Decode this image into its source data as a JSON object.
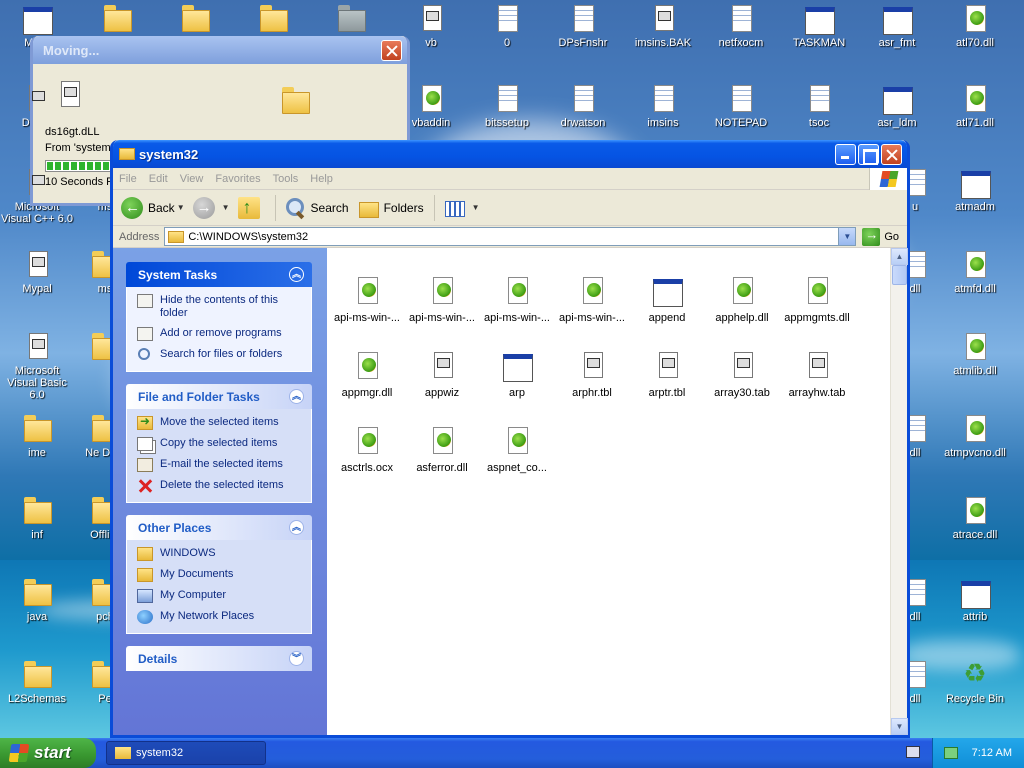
{
  "desktop": {
    "icons": [
      {
        "label": "My C",
        "kind": "win"
      },
      {
        "label": "",
        "kind": "folder"
      },
      {
        "label": "",
        "kind": "folder"
      },
      {
        "label": "",
        "kind": "folder"
      },
      {
        "label": "",
        "kind": "folder-gray"
      },
      {
        "label": "vb",
        "kind": "exe"
      },
      {
        "label": "0",
        "kind": "doc"
      },
      {
        "label": "DPsFnshr",
        "kind": "doc"
      },
      {
        "label": "imsins.BAK",
        "kind": "exe"
      },
      {
        "label": "netfxocm",
        "kind": "doc"
      },
      {
        "label": "TASKMAN",
        "kind": "win"
      },
      {
        "label": "asr_fmt",
        "kind": "win"
      },
      {
        "label": "atl70.dll",
        "kind": "dll"
      },
      {
        "label": "DataV",
        "kind": "exe"
      },
      {
        "label": "vbaddin",
        "kind": "dll"
      },
      {
        "label": "bitssetup",
        "kind": "doc"
      },
      {
        "label": "drwatson",
        "kind": "doc"
      },
      {
        "label": "imsins",
        "kind": "doc"
      },
      {
        "label": "NOTEPAD",
        "kind": "doc"
      },
      {
        "label": "tsoc",
        "kind": "doc"
      },
      {
        "label": "asr_ldm",
        "kind": "win"
      },
      {
        "label": "atl71.dll",
        "kind": "dll"
      },
      {
        "label": "Microsoft Visual C++ 6.0",
        "kind": "exe"
      },
      {
        "label": "ms",
        "kind": "folder"
      },
      {
        "label": "u",
        "kind": "doc"
      },
      {
        "label": "atmadm",
        "kind": "win"
      },
      {
        "label": "Mypal",
        "kind": "exe"
      },
      {
        "label": "ms",
        "kind": "folder"
      },
      {
        "label": "dll",
        "kind": "doc"
      },
      {
        "label": "atmfd.dll",
        "kind": "dll"
      },
      {
        "label": "Microsoft Visual Basic 6.0",
        "kind": "exe"
      },
      {
        "label": "",
        "kind": "folder"
      },
      {
        "label": "atmlib.dll",
        "kind": "dll"
      },
      {
        "label": "ime",
        "kind": "folder"
      },
      {
        "label": "Ne Diag",
        "kind": "folder"
      },
      {
        "label": "dll",
        "kind": "doc"
      },
      {
        "label": "atmpvcno.dll",
        "kind": "dll"
      },
      {
        "label": "inf",
        "kind": "folder"
      },
      {
        "label": "Offli P",
        "kind": "folder"
      },
      {
        "label": "atrace.dll",
        "kind": "dll"
      },
      {
        "label": "java",
        "kind": "folder"
      },
      {
        "label": "pch",
        "kind": "folder"
      },
      {
        "label": "dll",
        "kind": "doc"
      },
      {
        "label": "attrib",
        "kind": "win"
      },
      {
        "label": "L2Schemas",
        "kind": "folder"
      },
      {
        "label": "Pe",
        "kind": "folder"
      },
      {
        "label": "dll",
        "kind": "doc"
      },
      {
        "label": "Recycle Bin",
        "kind": "recycle"
      },
      {
        "label": "A",
        "kind": "doc"
      }
    ]
  },
  "moving_dialog": {
    "title": "Moving...",
    "file_name": "ds16gt.dLL",
    "from_text": "From 'system3",
    "time_text": "10 Seconds Re",
    "progress_blocks": 8
  },
  "explorer": {
    "title": "system32",
    "menu": [
      "File",
      "Edit",
      "View",
      "Favorites",
      "Tools",
      "Help"
    ],
    "toolbar": {
      "back": "Back",
      "search": "Search",
      "folders": "Folders"
    },
    "address": {
      "label": "Address",
      "value": "C:\\WINDOWS\\system32",
      "go": "Go"
    },
    "system_tasks": {
      "title": "System Tasks",
      "items": [
        {
          "label": "Hide the contents of this folder",
          "icon": "box"
        },
        {
          "label": "Add or remove programs",
          "icon": "box"
        },
        {
          "label": "Search for files or folders",
          "icon": "search"
        }
      ]
    },
    "file_tasks": {
      "title": "File and Folder Tasks",
      "items": [
        {
          "label": "Move the selected items",
          "icon": "move"
        },
        {
          "label": "Copy the selected items",
          "icon": "copy"
        },
        {
          "label": "E-mail the selected items",
          "icon": "mail"
        },
        {
          "label": "Delete the selected items",
          "icon": "delete"
        }
      ]
    },
    "other_places": {
      "title": "Other Places",
      "items": [
        {
          "label": "WINDOWS",
          "icon": "folder"
        },
        {
          "label": "My Documents",
          "icon": "docs"
        },
        {
          "label": "My Computer",
          "icon": "mycomp"
        },
        {
          "label": "My Network Places",
          "icon": "net"
        }
      ]
    },
    "details": {
      "title": "Details"
    },
    "files": [
      {
        "name": "api-ms-win-...",
        "kind": "dll"
      },
      {
        "name": "api-ms-win-...",
        "kind": "dll"
      },
      {
        "name": "api-ms-win-...",
        "kind": "dll"
      },
      {
        "name": "api-ms-win-...",
        "kind": "dll"
      },
      {
        "name": "append",
        "kind": "win"
      },
      {
        "name": "apphelp.dll",
        "kind": "dll"
      },
      {
        "name": "appmgmts.dll",
        "kind": "dll"
      },
      {
        "name": "appmgr.dll",
        "kind": "dll"
      },
      {
        "name": "appwiz",
        "kind": "exe"
      },
      {
        "name": "arp",
        "kind": "win"
      },
      {
        "name": "arphr.tbl",
        "kind": "exe"
      },
      {
        "name": "arptr.tbl",
        "kind": "exe"
      },
      {
        "name": "array30.tab",
        "kind": "exe"
      },
      {
        "name": "arrayhw.tab",
        "kind": "exe"
      },
      {
        "name": "asctrls.ocx",
        "kind": "dll"
      },
      {
        "name": "asferror.dll",
        "kind": "dll"
      },
      {
        "name": "aspnet_co...",
        "kind": "dll"
      }
    ]
  },
  "taskbar": {
    "start": "start",
    "task": "system32",
    "clock": "7:12 AM"
  }
}
